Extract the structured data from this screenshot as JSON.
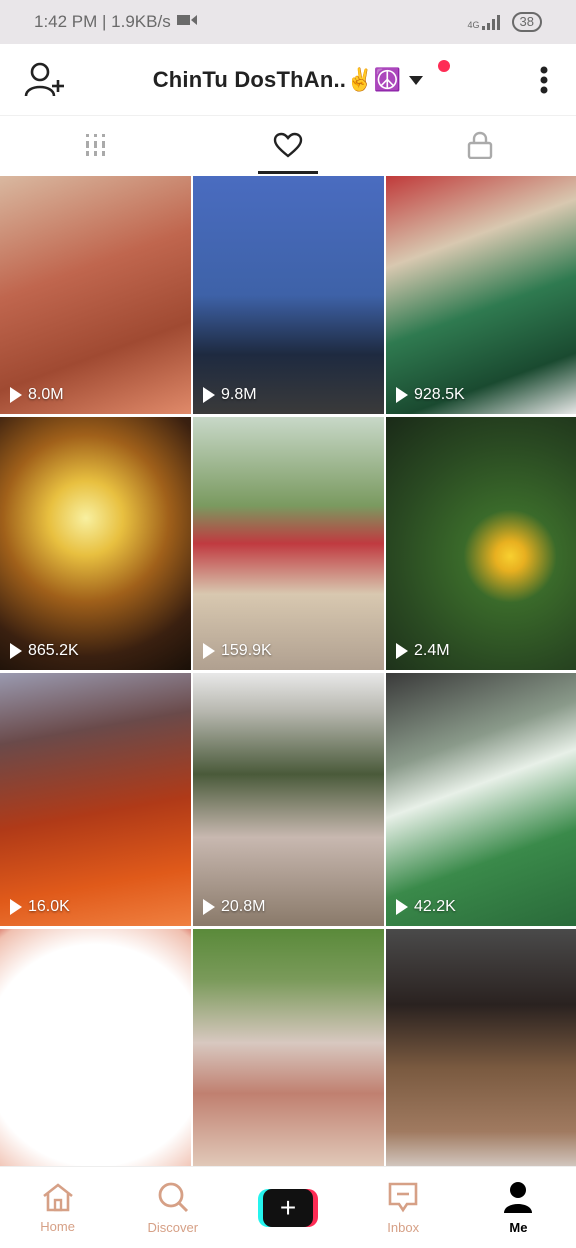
{
  "status": {
    "time_speed": "1:42 PM | 1.9KB/s",
    "network": "4G",
    "battery": "38"
  },
  "header": {
    "username": "ChinTu DosThAn..✌️☮️",
    "notification_color": "#fe2c55"
  },
  "tabs": [
    {
      "icon": "grid-icon"
    },
    {
      "icon": "heart-icon",
      "active": true
    },
    {
      "icon": "lock-icon"
    }
  ],
  "videos": [
    {
      "views": "8.0M",
      "bg": "#c0664e"
    },
    {
      "views": "9.8M",
      "bg": "#3e62a8"
    },
    {
      "views": "928.5K",
      "bg": "#3f7a50"
    },
    {
      "views": "865.2K",
      "bg": "#8a6a2a"
    },
    {
      "views": "159.9K",
      "bg": "#7d8a6a"
    },
    {
      "views": "2.4M",
      "bg": "#2d4a2a"
    },
    {
      "views": "16.0K",
      "bg": "#8a2a12"
    },
    {
      "views": "20.8M",
      "bg": "#6a6455"
    },
    {
      "views": "42.2K",
      "bg": "#4a5a4a"
    },
    {
      "views": "",
      "bg": "#ffffff"
    },
    {
      "views": "",
      "bg": "#6a7a5a"
    },
    {
      "views": "",
      "bg": "#3a3632"
    }
  ],
  "nav": {
    "home": "Home",
    "discover": "Discover",
    "inbox": "Inbox",
    "me": "Me"
  },
  "colors": {
    "accent": "#fe2c55",
    "accent2": "#25f4ee",
    "nav_inactive": "#d6a086"
  }
}
